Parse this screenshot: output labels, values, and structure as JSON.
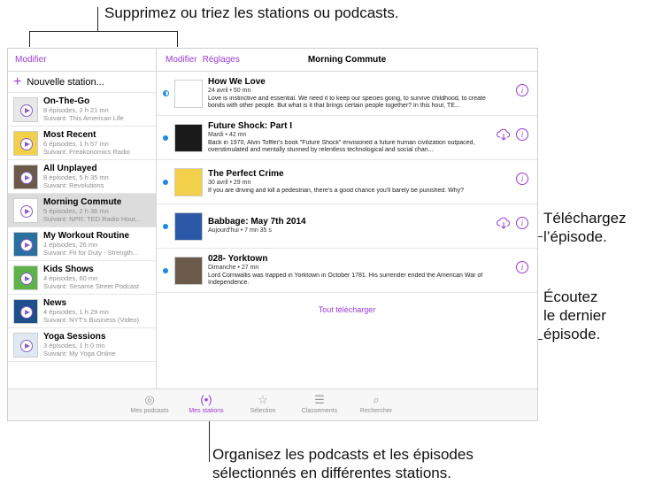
{
  "callouts": {
    "top": "Supprimez ou triez les stations ou podcasts.",
    "download": [
      "Téléchargez",
      "l’épisode."
    ],
    "listen": [
      "Écoutez",
      "le dernier",
      "épisode."
    ],
    "bottom": [
      "Organisez les podcasts et les épisodes",
      "sélectionnés en différentes stations."
    ]
  },
  "left": {
    "edit_label": "Modifier",
    "new_station": "Nouvelle station...",
    "stations": [
      {
        "title": "On-The-Go",
        "sub1": "8 épisodes, 2 h 21 mn",
        "sub2": "Suivant: This American Life",
        "art": "#e8e8e8"
      },
      {
        "title": "Most Recent",
        "sub1": "6 épisodes, 1 h 57 mn",
        "sub2": "Suivant: Freakonomics Radio",
        "art": "#f3d04a"
      },
      {
        "title": "All Unplayed",
        "sub1": "8 épisodes, 5 h 35 mn",
        "sub2": "Suivant: Revolutions",
        "art": "#6b5a4a"
      },
      {
        "title": "Morning Commute",
        "sub1": "5 épisodes, 2 h 36 mn",
        "sub2": "Suivant: NPR: TED Radio Hour...",
        "art": "#ffffff"
      },
      {
        "title": "My Workout Routine",
        "sub1": "1 épisodes, 26 mn",
        "sub2": "Suivant: Fit for Duty - Strength...",
        "art": "#2a6f9e"
      },
      {
        "title": "Kids Shows",
        "sub1": "4 épisodes, 60 mn",
        "sub2": "Suivant: Sesame Street Podcast",
        "art": "#5db34a"
      },
      {
        "title": "News",
        "sub1": "4 épisodes, 1 h 29 mn",
        "sub2": "Suivant: NYT's Business (Video)",
        "art": "#1d4f8a"
      },
      {
        "title": "Yoga Sessions",
        "sub1": "3 épisodes, 1 h 0 mn",
        "sub2": "Suivant: My Yoga Online",
        "art": "#dfe9f3"
      }
    ]
  },
  "right": {
    "edit_label": "Modifier",
    "settings_label": "Réglages",
    "title": "Morning Commute",
    "episodes": [
      {
        "title": "How We Love",
        "meta": "24 avril • 50 mn",
        "desc": "Love is instinctive and essential. We need it to keep our species going, to survive childhood, to create bonds with other people. But what is it that brings certain people together? In this hour, TE...",
        "art": "#ffffff",
        "dot": "half",
        "cloud": false
      },
      {
        "title": "Future Shock: Part I",
        "meta": "Mardi • 42 mn",
        "desc": "Back in 1970, Alvin Toffler's book \"Future Shock\" envisioned a future human civilization outpaced, overstimulated and mentally stunned by relentless technological and social chan...",
        "art": "#1a1a1a",
        "dot": "full",
        "cloud": true
      },
      {
        "title": "The Perfect Crime",
        "meta": "30 avril • 29 mn",
        "desc": "If you are driving and kill a pedestrian, there's a good chance you'll barely be punished. Why?",
        "art": "#f3d04a",
        "dot": "full",
        "cloud": false
      },
      {
        "title": "Babbage: May 7th 2014",
        "meta": "Aujourd'hui • 7 mn 35 s",
        "desc": "",
        "art": "#2b59a8",
        "dot": "full",
        "cloud": true
      },
      {
        "title": "028- Yorktown",
        "meta": "Dimanche • 27 mn",
        "desc": "Lord Cornwallis was trapped in Yorktown in October 1781. His surrender ended the American War of Independence.",
        "art": "#6b5a4a",
        "dot": "full",
        "cloud": false
      }
    ],
    "download_all": "Tout télécharger"
  },
  "tabbar": [
    {
      "label": "Mes podcasts",
      "icon": "podcast-icon",
      "glyph": "◎"
    },
    {
      "label": "Mes stations",
      "icon": "stations-icon",
      "glyph": "(•)"
    },
    {
      "label": "Sélection",
      "icon": "star-icon",
      "glyph": "☆"
    },
    {
      "label": "Classements",
      "icon": "list-icon",
      "glyph": "☰"
    },
    {
      "label": "Rechercher",
      "icon": "search-icon",
      "glyph": "⌕"
    }
  ],
  "colors": {
    "accent": "#9b3bd6",
    "unplayed_dot": "#1e88e5"
  }
}
